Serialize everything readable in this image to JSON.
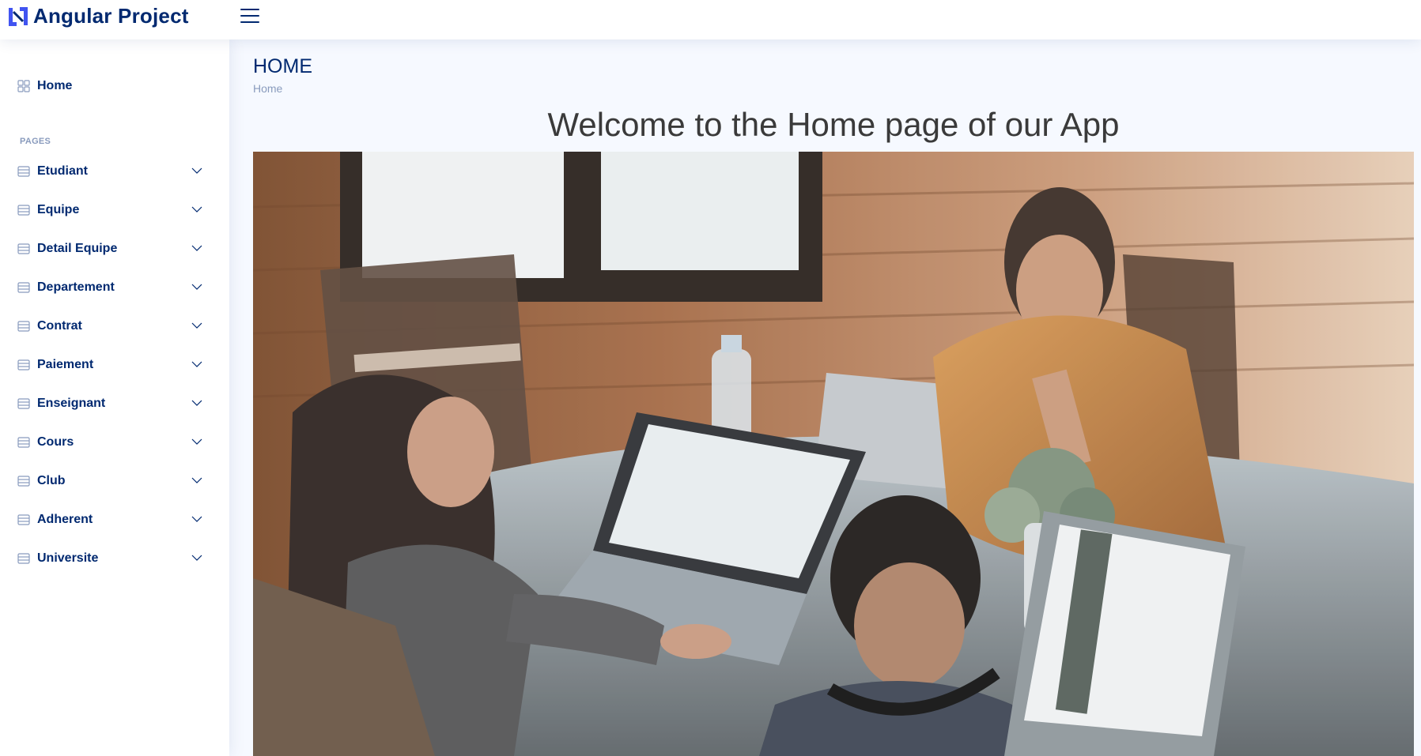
{
  "app": {
    "brand_name": "Angular Project",
    "brand_color": "#012970",
    "accent_color": "#4154f1"
  },
  "header": {
    "toggle_icon": "hamburger-icon"
  },
  "sidebar": {
    "home_label": "Home",
    "pages_heading": "PAGES",
    "items": [
      {
        "label": "Etudiant"
      },
      {
        "label": "Equipe"
      },
      {
        "label": "Detail Equipe"
      },
      {
        "label": "Departement"
      },
      {
        "label": "Contrat"
      },
      {
        "label": "Paiement"
      },
      {
        "label": "Enseignant"
      },
      {
        "label": "Cours"
      },
      {
        "label": "Club"
      },
      {
        "label": "Adherent"
      },
      {
        "label": "Universite"
      }
    ],
    "item_icon": "layout-text-icon",
    "expand_icon": "chevron-down-icon"
  },
  "main": {
    "page_title": "HOME",
    "breadcrumb": "Home",
    "welcome_text": "Welcome to the Home page of our App",
    "hero_image": "team-working-on-laptops-photo"
  }
}
